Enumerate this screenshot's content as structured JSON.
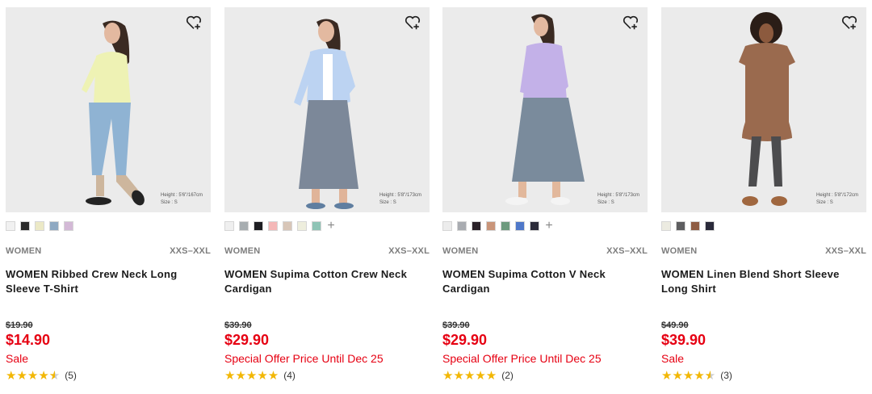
{
  "products": [
    {
      "category": "WOMEN",
      "sizes": "XXS–XXL",
      "name": "WOMEN Ribbed Crew Neck Long Sleeve T-Shirt",
      "original_price": "$19.90",
      "price": "$14.90",
      "flag": "Sale",
      "stars": "★★★★",
      "rating_count": "(5)",
      "model_note": [
        "Height : 5'6\"/167cm",
        "Size : S"
      ],
      "wishlist_icon": "heart-plus-icon",
      "colors": [
        "#f1f1f1",
        "#2b2b2b",
        "#ece9c6",
        "#8fa9c2",
        "#d3b9d6"
      ],
      "more_colors": ""
    },
    {
      "category": "WOMEN",
      "sizes": "XXS–XXL",
      "name": "WOMEN Supima Cotton Crew Neck Cardigan",
      "original_price": "$39.90",
      "price": "$29.90",
      "flag": "Special Offer Price Until Dec 25",
      "stars": "★★★★★",
      "rating_count": "(4)",
      "model_note": [
        "Height : 5'8\"/173cm",
        "Size : S"
      ],
      "wishlist_icon": "heart-plus-icon",
      "colors": [
        "#efefef",
        "#a7adb0",
        "#1e1e22",
        "#f4b7b7",
        "#d8c6b8",
        "#eeeedd",
        "#8fc4b6"
      ],
      "more_colors": "+"
    },
    {
      "category": "WOMEN",
      "sizes": "XXS–XXL",
      "name": "WOMEN Supima Cotton V Neck Cardigan",
      "original_price": "$39.90",
      "price": "$29.90",
      "flag": "Special Offer Price Until Dec 25",
      "stars": "★★★★★",
      "rating_count": "(2)",
      "model_note": [
        "Height : 5'8\"/173cm",
        "Size : S"
      ],
      "wishlist_icon": "heart-plus-icon",
      "colors": [
        "#ececec",
        "#a9acb1",
        "#2a2228",
        "#c9957a",
        "#6e9a7e",
        "#4f78c9",
        "#2c2c3a"
      ],
      "more_colors": "+"
    },
    {
      "category": "WOMEN",
      "sizes": "XXS–XXL",
      "name": "WOMEN Linen Blend Short Sleeve Long Shirt",
      "original_price": "$49.90",
      "price": "$39.90",
      "flag": "Sale",
      "stars": "★★★★",
      "rating_count": "(3)",
      "model_note": [
        "Height : 5'8\"/172cm",
        "Size : S"
      ],
      "wishlist_icon": "heart-plus-icon",
      "colors": [
        "#ecebe1",
        "#5e5e60",
        "#8e5d44",
        "#2a2a3a"
      ],
      "more_colors": ""
    }
  ]
}
